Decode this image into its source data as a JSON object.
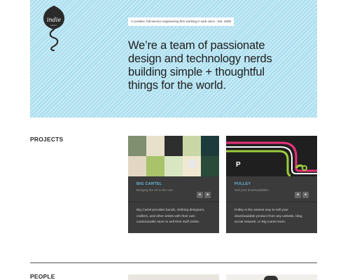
{
  "hero": {
    "logo_text": "indie",
    "logo_subtext": "labs",
    "tagline": "A creative, full-service engineering firm working in web since - Est. 2005",
    "headline_lines": [
      "We’re a team of passionate",
      "design and technology nerds",
      "building simple + thoughtful",
      "things for the world."
    ],
    "background_color": "#aee0f0"
  },
  "sections": {
    "projects_label": "PROJECTS",
    "people_label": "PEOPLE"
  },
  "projects": [
    {
      "name": "BIG CARTEL",
      "subtitle": "Bringing the art to the cart",
      "description": "Big Cartel provides bands, clothing designers, crafters, and other artists with their own customizable store to sell their stuff online."
    },
    {
      "name": "PULLEY",
      "subtitle": "Sell your downloadables",
      "description": "Pulley is the easiest way to sell your downloadable product from any website, blog, social network, or Big Cartel store."
    }
  ],
  "colors": {
    "card_bg": "#3b3b3b",
    "project_name": "#6ab9dc",
    "pulley_stripes": [
      "#e8317a",
      "#ffffff",
      "#9ccc3c"
    ]
  }
}
